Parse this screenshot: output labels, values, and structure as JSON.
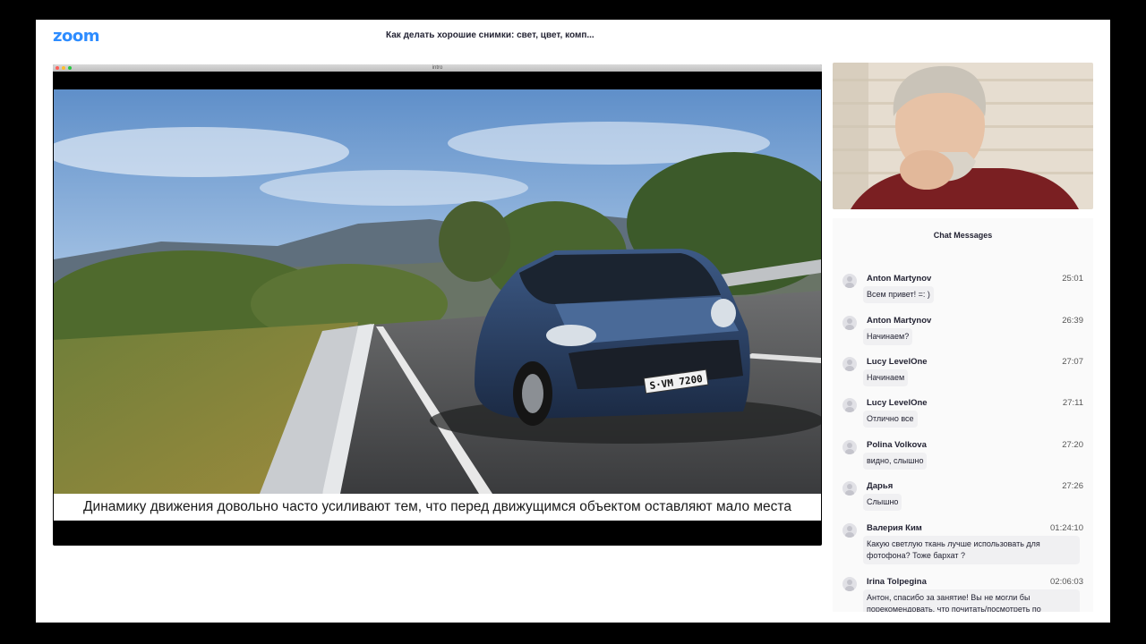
{
  "app": {
    "logo": "zoom",
    "meeting_title": "Как делать хорошие снимки: свет, цвет, комп..."
  },
  "shared_screen": {
    "window_title": "intro",
    "caption": "Динамику движения довольно часто усиливают тем, что перед движущимся объектом оставляют мало места",
    "license_plate": "S·VM 7200"
  },
  "chat": {
    "header": "Chat Messages",
    "messages": [
      {
        "sender": "Anton Martynov",
        "time": "25:01",
        "text": "Всем привет! =: )"
      },
      {
        "sender": "Anton Martynov",
        "time": "26:39",
        "text": "Начинаем?"
      },
      {
        "sender": "Lucy LevelOne",
        "time": "27:07",
        "text": "Начинаем"
      },
      {
        "sender": "Lucy LevelOne",
        "time": "27:11",
        "text": "Отлично все"
      },
      {
        "sender": "Polina Volkova",
        "time": "27:20",
        "text": "видно, слышно"
      },
      {
        "sender": "Дарья",
        "time": "27:26",
        "text": "Слышно"
      },
      {
        "sender": "Валерия Ким",
        "time": "01:24:10",
        "text": "Какую светлую ткань лучше использовать для фотофона? Тоже бархат ?"
      },
      {
        "sender": "Irina Tolpegina",
        "time": "02:06:03",
        "text": "Антон, спасибо за занятие! Вы не могли бы порекомендовать, что почитать/посмотреть по"
      }
    ]
  },
  "colors": {
    "brand": "#2d8cff",
    "chat_bubble": "#f0f0f2",
    "background": "#000000"
  }
}
